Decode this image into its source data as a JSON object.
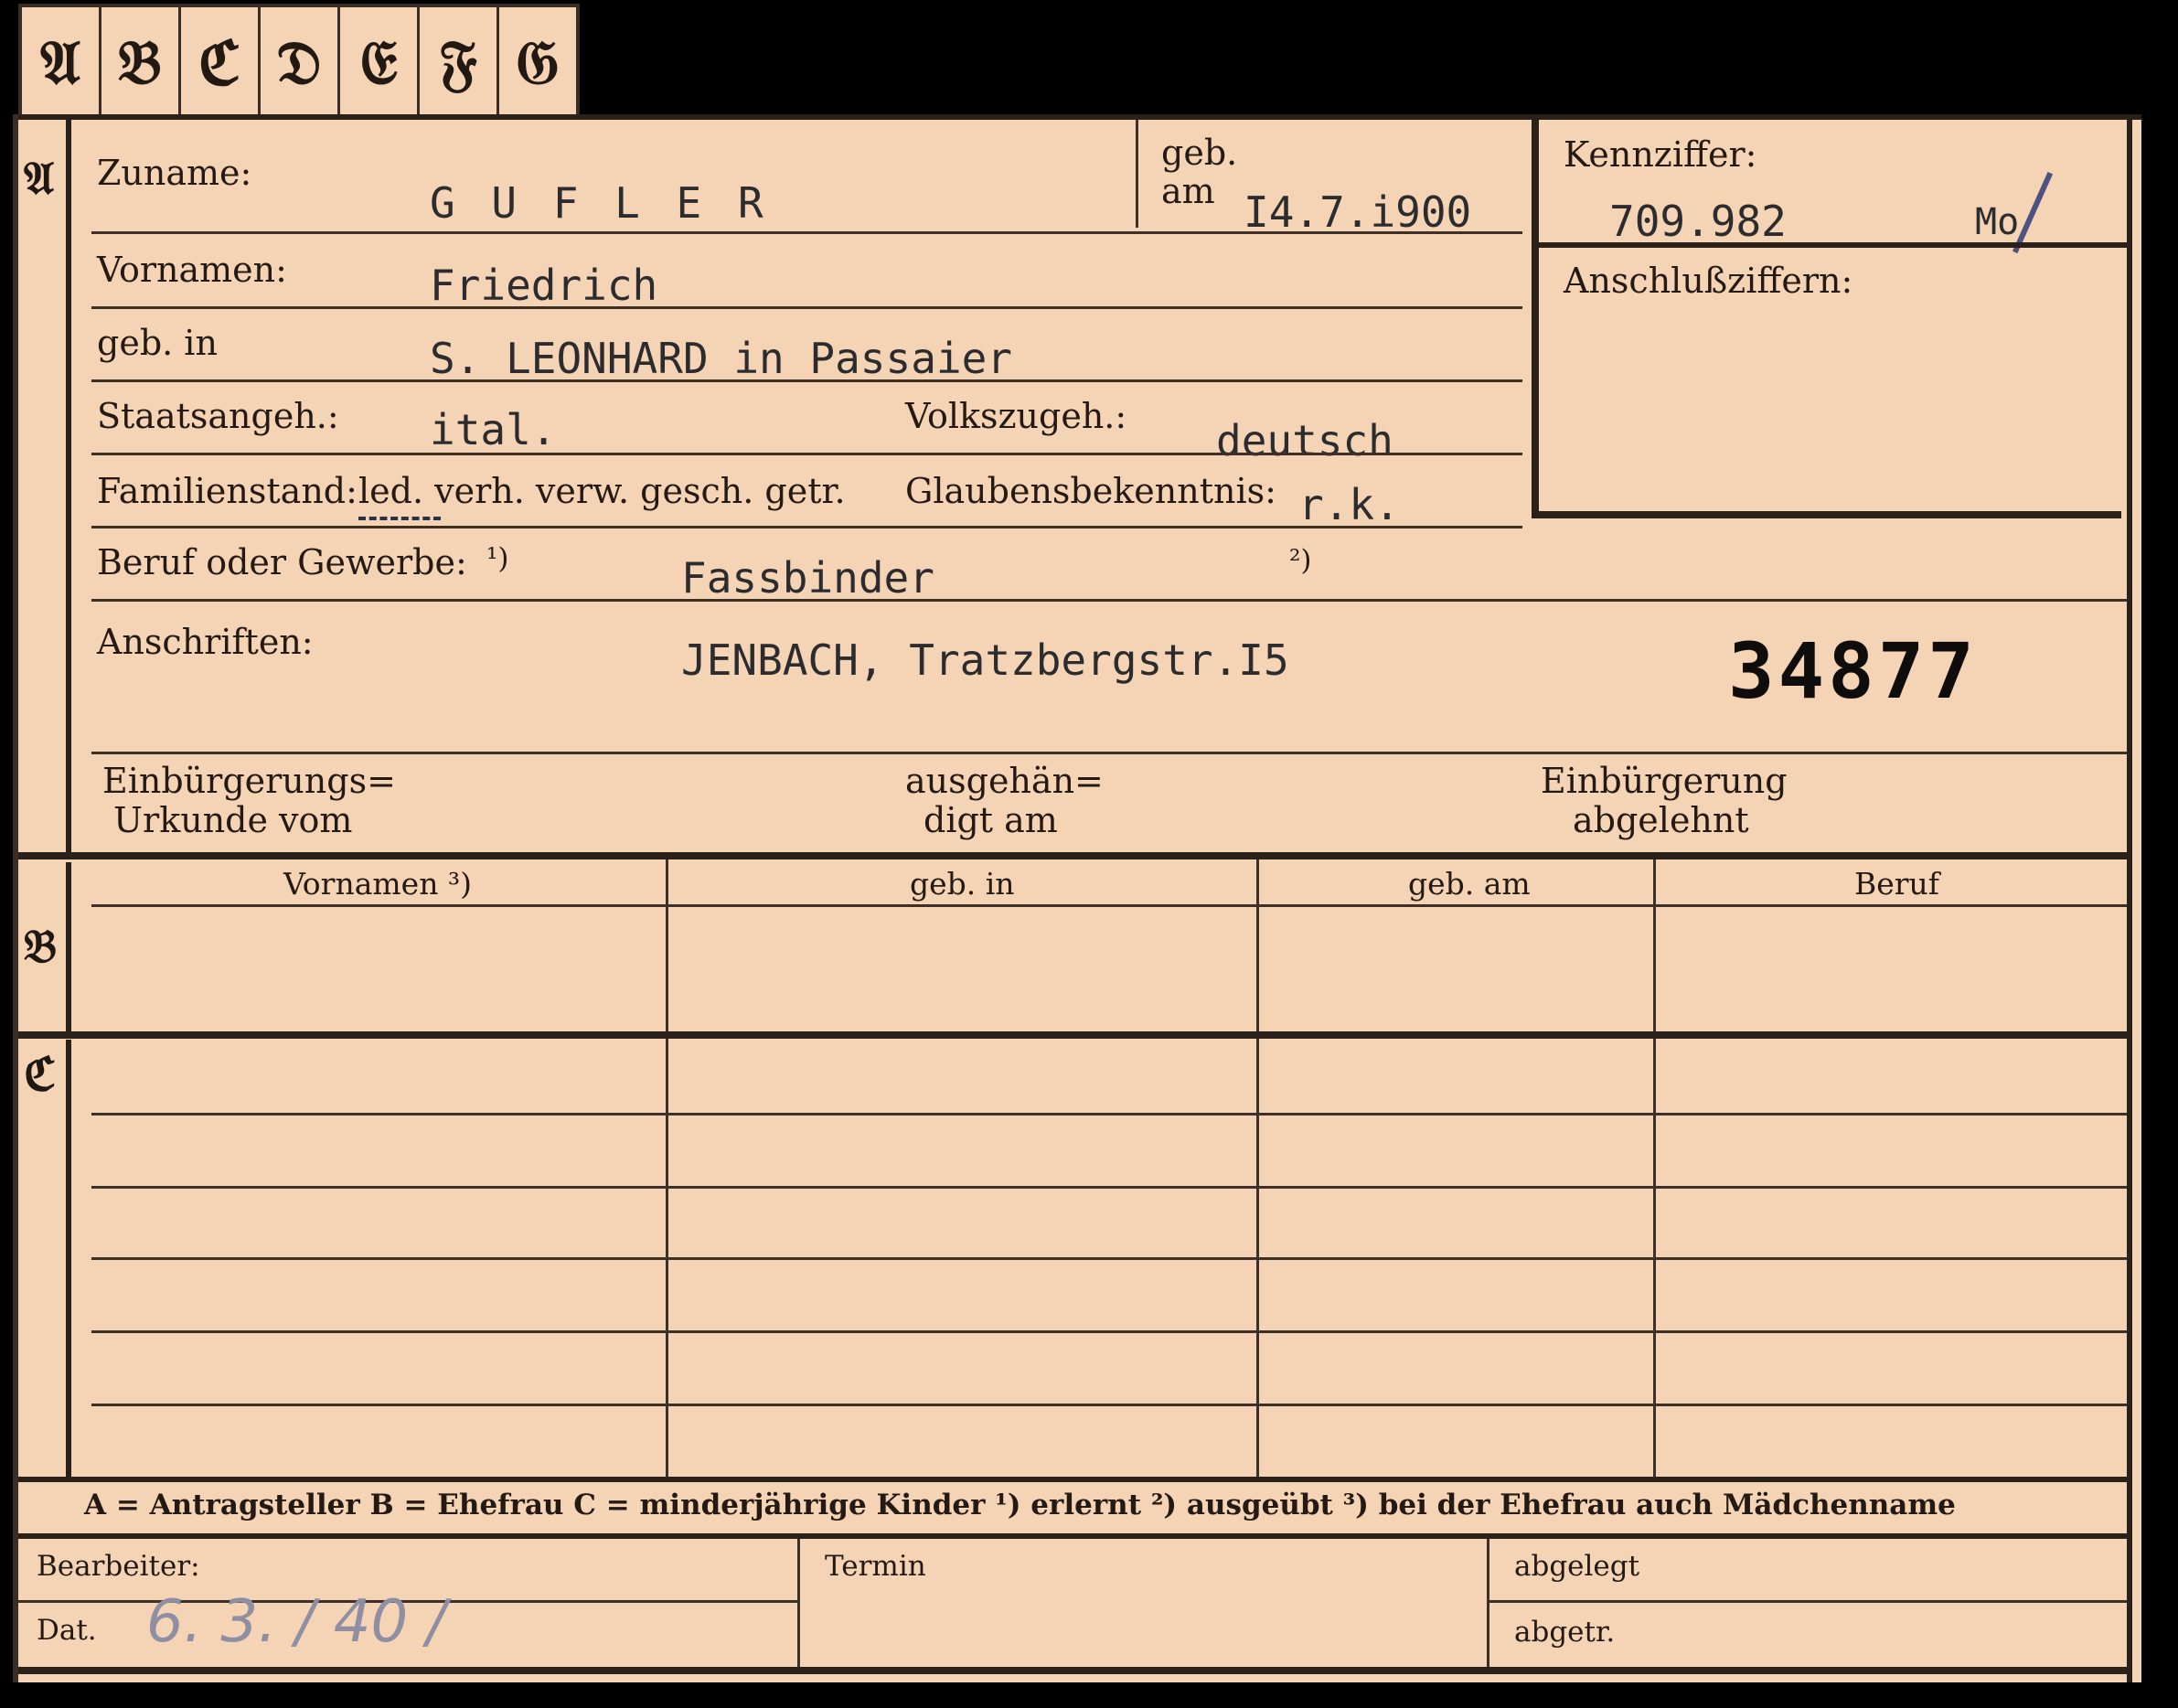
{
  "tabs": [
    "𝔄",
    "𝔅",
    "ℭ",
    "𝔇",
    "𝔈",
    "𝔉",
    "𝔊"
  ],
  "sections": {
    "a": "𝔄",
    "b": "𝔅",
    "c": "ℭ"
  },
  "person": {
    "surname_label": "Zuname:",
    "surname_value": "G U F L E R",
    "born_label_1": "geb.",
    "born_label_2": "am",
    "born_value": "I4.7.i900",
    "firstnames_label": "Vornamen:",
    "firstnames_value": "Friedrich",
    "birthplace_label": "geb. in",
    "birthplace_value": "S. LEONHARD in Passaier",
    "citizenship_label": "Staatsangeh.:",
    "citizenship_value": "ital.",
    "ethnicity_label": "Volkszugeh.:",
    "ethnicity_value": "deutsch",
    "marital_label": "Familienstand:",
    "marital_options": "led. verh. verw. gesch. getr.",
    "religion_label": "Glaubensbekenntnis:",
    "religion_value": "r.k.",
    "occupation_label": "Beruf oder Gewerbe:",
    "footnote_1": "¹)",
    "occupation_value": "Fassbinder",
    "footnote_2": "²)",
    "address_label": "Anschriften:",
    "address_value": "JENBACH, Tratzbergstr.I5",
    "stamp_number": "34877",
    "naturalization_label_1": "Einbürgerungs=",
    "naturalization_label_2": "Urkunde vom",
    "handed_label_1": "ausgehän=",
    "handed_label_2": "digt am",
    "refused_label_1": "Einbürgerung",
    "refused_label_2": "abgelehnt"
  },
  "id_box": {
    "label": "Kennziffer:",
    "value": "709.982",
    "suffix": "Mo",
    "linked_label": "Anschlußziffern:"
  },
  "table": {
    "headers": [
      "Vornamen ³)",
      "geb. in",
      "geb. am",
      "Beruf"
    ]
  },
  "legend": "A = Antragsteller   B = Ehefrau   C = minderjährige Kinder   ¹) erlernt   ²) ausgeübt   ³) bei der Ehefrau auch Mädchenname",
  "footer": {
    "clerk_label": "Bearbeiter:",
    "date_label": "Dat.",
    "date_value": "6. 3. / 40 /",
    "deadline_label": "Termin",
    "filed_label": "abgelegt",
    "filed2_label": "abgetr."
  }
}
